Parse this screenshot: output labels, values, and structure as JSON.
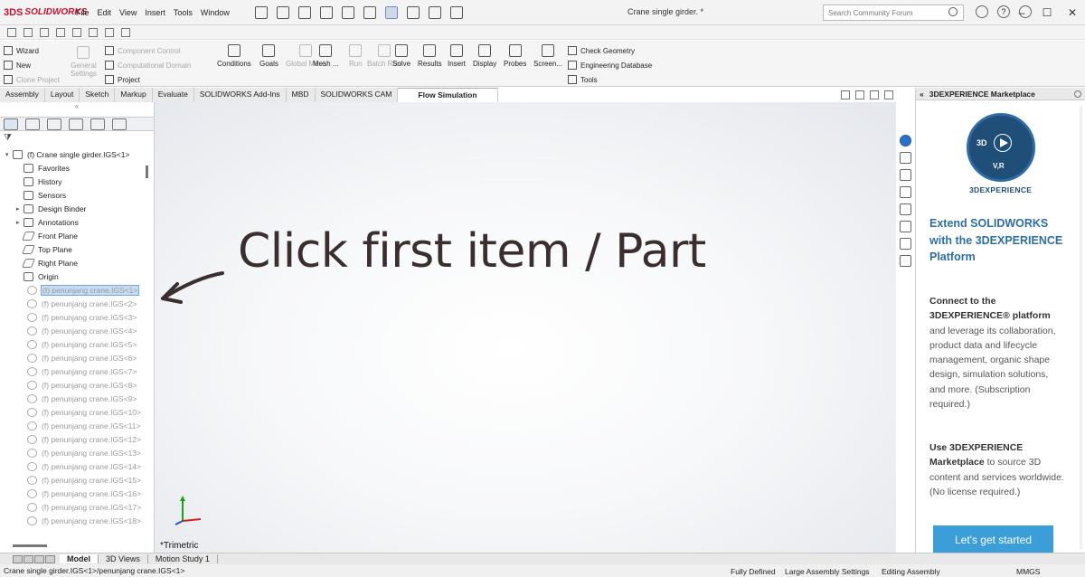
{
  "app": {
    "name": "SOLIDWORKS",
    "logo_mark": "3DS"
  },
  "menu": [
    "File",
    "Edit",
    "View",
    "Insert",
    "Tools",
    "Window"
  ],
  "document_title": "Crane single girder. *",
  "search": {
    "placeholder": "Search Community Forum"
  },
  "ribbon": {
    "left_column": [
      {
        "label": "Wizard",
        "disabled": false
      },
      {
        "label": "New",
        "disabled": false
      },
      {
        "label": "Clone Project",
        "disabled": true
      }
    ],
    "general_settings": {
      "line1": "General",
      "line2": "Settings"
    },
    "middle_column": [
      {
        "label": "Component Control",
        "disabled": true
      },
      {
        "label": "Computational Domain",
        "disabled": true
      },
      {
        "label": "Project",
        "disabled": false
      }
    ],
    "buttons": [
      {
        "label": "Conditions",
        "disabled": false
      },
      {
        "label": "Goals",
        "disabled": false
      },
      {
        "label": "Global Mesh",
        "disabled": true
      },
      {
        "label": "Mesh ...",
        "disabled": false
      },
      {
        "label": "Run",
        "disabled": true
      },
      {
        "label": "Batch Run",
        "disabled": true
      },
      {
        "label": "Solve",
        "disabled": false
      },
      {
        "label": "Results",
        "disabled": false
      },
      {
        "label": "Insert",
        "disabled": false
      },
      {
        "label": "Display",
        "disabled": false
      },
      {
        "label": "Probes",
        "disabled": false
      },
      {
        "label": "Screen...",
        "disabled": false
      }
    ],
    "right_column": [
      "Check Geometry",
      "Engineering Database",
      "Tools"
    ]
  },
  "tabs": [
    "Assembly",
    "Layout",
    "Sketch",
    "Markup",
    "Evaluate",
    "SOLIDWORKS Add-Ins",
    "MBD",
    "SOLIDWORKS CAM",
    "Flow Simulation"
  ],
  "active_tab": "Flow Simulation",
  "tree": {
    "root": "(f) Crane single girder.IGS<1>",
    "folders": [
      "Favorites",
      "History",
      "Sensors",
      "Design Binder",
      "Annotations",
      "Front Plane",
      "Top Plane",
      "Right Plane",
      "Origin"
    ],
    "parts": [
      "(f) penunjang crane.IGS<1>",
      "(f) penunjang crane.IGS<2>",
      "(f) penunjang crane.IGS<3>",
      "(f) penunjang crane.IGS<4>",
      "(f) penunjang crane.IGS<5>",
      "(f) penunjang crane.IGS<6>",
      "(f) penunjang crane.IGS<7>",
      "(f) penunjang crane.IGS<8>",
      "(f) penunjang crane.IGS<9>",
      "(f) penunjang crane.IGS<10>",
      "(f) penunjang crane.IGS<11>",
      "(f) penunjang crane.IGS<12>",
      "(f) penunjang crane.IGS<13>",
      "(f) penunjang crane.IGS<14>",
      "(f) penunjang crane.IGS<15>",
      "(f) penunjang crane.IGS<16>",
      "(f) penunjang crane.IGS<17>",
      "(f) penunjang crane.IGS<18>"
    ]
  },
  "annotation": "Click first item / Part",
  "view_label": "*Trimetric",
  "marketplace": {
    "header": "3DEXPERIENCE Marketplace",
    "badge_3d": "3D",
    "badge_vr": "V,R",
    "brand": "3DEXPERIENCE",
    "title": "Extend SOLIDWORKS with the 3DEXPERIENCE Platform",
    "body1_lead": "Connect to the 3DEXPERIENCE® platform",
    "body1_rest": " and leverage its collaboration, product data and lifecycle management, organic shape design, simulation solutions, and more. (Subscription required.)",
    "body2_lead": "Use 3DEXPERIENCE Marketplace",
    "body2_rest": " to source 3D content and services worldwide. (No license required.)",
    "cta": "Let's get started"
  },
  "bottom_tabs": [
    "Model",
    "3D Views",
    "Motion Study 1"
  ],
  "status": {
    "path": "Crane single girder.IGS<1>/penunjang crane.IGS<1>",
    "definition": "Fully Defined",
    "settings": "Large Assembly Settings",
    "mode": "Editing Assembly",
    "units": "MMGS"
  }
}
